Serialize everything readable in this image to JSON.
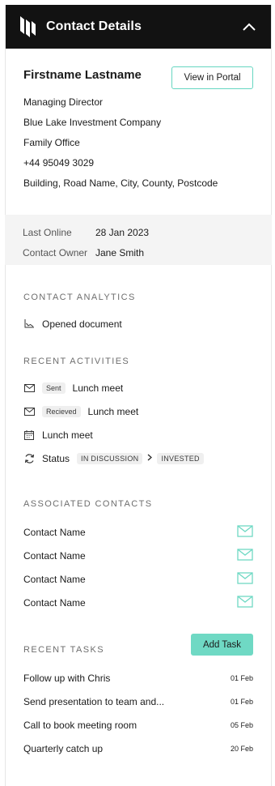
{
  "header": {
    "title": "Contact Details",
    "logo_icon": "brand-logo-icon",
    "collapse_icon": "chevron-up-icon"
  },
  "profile": {
    "name": "Firstname Lastname",
    "view_portal_label": "View in Portal",
    "role": "Managing Director",
    "company": "Blue Lake Investment Company",
    "type": "Family Office",
    "phone": "+44 95049 3029",
    "address": "Building, Road Name, City, County, Postcode"
  },
  "meta": {
    "last_online_label": "Last Online",
    "last_online_value": "28 Jan 2023",
    "owner_label": "Contact Owner",
    "owner_value": "Jane Smith"
  },
  "analytics": {
    "title": "CONTACT ANALYTICS",
    "items": [
      {
        "icon": "chart-icon",
        "label": "Opened document"
      }
    ]
  },
  "activities": {
    "title": "RECENT ACTIVITIES",
    "items": [
      {
        "icon": "mail-icon",
        "badge": "Sent",
        "label": "Lunch meet"
      },
      {
        "icon": "mail-icon",
        "badge": "Recieved",
        "label": "Lunch meet"
      },
      {
        "icon": "calendar-icon",
        "label": "Lunch meet"
      }
    ],
    "status": {
      "icon": "refresh-icon",
      "label": "Status",
      "from": "IN DISCUSSION",
      "to": "INVESTED"
    }
  },
  "associated": {
    "title": "ASSOCIATED CONTACTS",
    "contacts": [
      "Contact Name",
      "Contact Name",
      "Contact Name",
      "Contact Name"
    ]
  },
  "tasks": {
    "title": "RECENT TASKS",
    "add_label": "Add Task",
    "items": [
      {
        "label": "Follow up with Chris",
        "date": "01 Feb"
      },
      {
        "label": "Send presentation to team and...",
        "date": "01 Feb"
      },
      {
        "label": "Call to book meeting room",
        "date": "05 Feb"
      },
      {
        "label": "Quarterly catch up",
        "date": "20 Feb"
      }
    ]
  },
  "colors": {
    "accent": "#6fd9c4",
    "header_bg": "#121212",
    "meta_bg": "#f4f4f4"
  }
}
